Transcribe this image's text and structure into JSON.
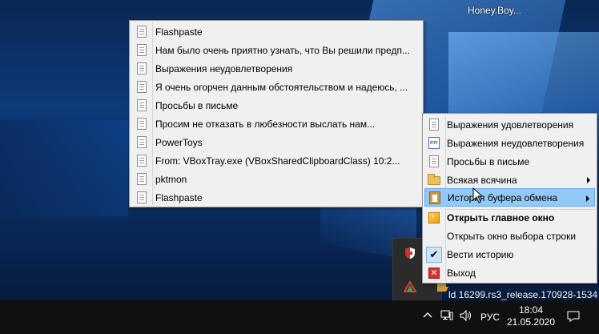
{
  "desktop": {
    "user_label": "Honey.Boy...",
    "watermark": "ld 16299.rs3_release.170928-1534"
  },
  "history_menu": {
    "items": [
      {
        "label": "Flashpaste",
        "icon": "document-icon"
      },
      {
        "label": "Нам было очень приятно узнать, что Вы решили предп...",
        "icon": "document-icon"
      },
      {
        "label": "Выражения неудовлетворения",
        "icon": "document-icon"
      },
      {
        "label": "Я очень огорчен данным обстоятельством и надеюсь, ...",
        "icon": "document-icon"
      },
      {
        "label": "Просьбы в письме",
        "icon": "document-icon"
      },
      {
        "label": "Просим не отказать в любезности выслать нам...",
        "icon": "document-icon"
      },
      {
        "label": "PowerToys",
        "icon": "document-icon"
      },
      {
        "label": "From: VBoxTray.exe (VBoxSharedClipboardClass) 10:2...",
        "icon": "document-icon"
      },
      {
        "label": "pktmon",
        "icon": "document-icon"
      },
      {
        "label": "Flashpaste",
        "icon": "document-icon"
      }
    ]
  },
  "tray_menu": {
    "items": [
      {
        "label": "Выражения удовлетворения",
        "icon": "document-icon"
      },
      {
        "label": "Выражения неудовлетворения",
        "icon": "rtf-document-icon"
      },
      {
        "label": "Просьбы в письме",
        "icon": "document-icon"
      },
      {
        "label": "Всякая всячина",
        "icon": "folder-icon",
        "submenu": true
      },
      {
        "label": "История буфера обмена",
        "icon": "clipboard-icon",
        "submenu": true,
        "highlighted": true
      },
      {
        "label": "Открыть главное окно",
        "icon": "open-window-icon",
        "bold": true
      },
      {
        "label": "Открыть окно выбора строки",
        "icon": ""
      },
      {
        "label": "Вести историю",
        "icon": "checkmark-icon",
        "checked": true
      },
      {
        "label": "Выход",
        "icon": "exit-icon"
      }
    ]
  },
  "taskbar": {
    "language": "РУС",
    "time": "18:04",
    "date": "21.05.2020"
  },
  "colors": {
    "menu_bg": "#f0f0f0",
    "highlight": "#91c9f7",
    "taskbar": "#101010"
  }
}
